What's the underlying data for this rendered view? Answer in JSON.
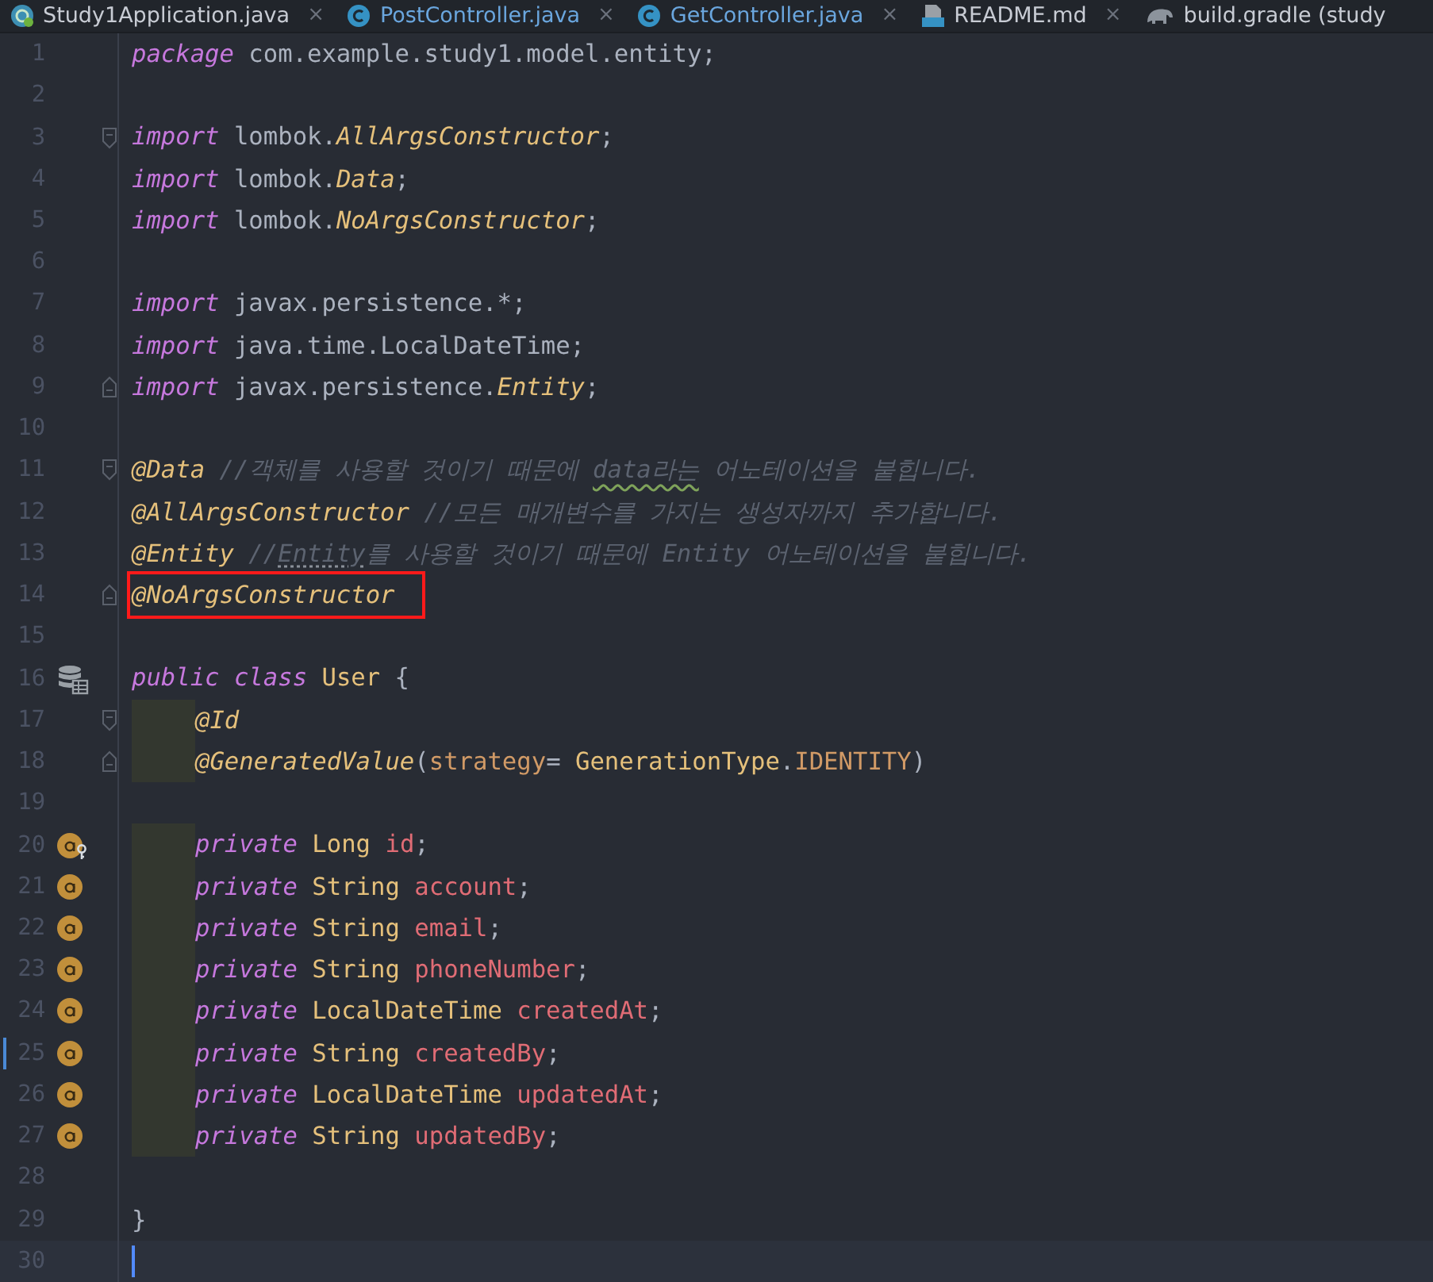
{
  "tabs": [
    {
      "label": "Study1Application.java",
      "kind": "app",
      "modified": false,
      "close": "×"
    },
    {
      "label": "PostController.java",
      "kind": "class",
      "modified": true,
      "close": "×"
    },
    {
      "label": "GetController.java",
      "kind": "class",
      "modified": true,
      "close": "×"
    },
    {
      "label": "README.md",
      "kind": "markdown",
      "modified": false,
      "close": "×"
    },
    {
      "label": "build.gradle (study",
      "kind": "gradle",
      "modified": false
    }
  ],
  "lines": [
    {
      "number": "1",
      "tokens": [
        {
          "kind": "keyword",
          "text": "package"
        },
        {
          "kind": "plain",
          "text": " com.example.study1.model.entity;"
        }
      ]
    },
    {
      "number": "2"
    },
    {
      "number": "3",
      "fold_start": true,
      "tokens": [
        {
          "kind": "keyword",
          "text": "import"
        },
        {
          "kind": "plain",
          "text": " lombok."
        },
        {
          "kind": "class",
          "text": "AllArgsConstructor"
        },
        {
          "kind": "plain",
          "text": ";"
        }
      ]
    },
    {
      "number": "4",
      "tokens": [
        {
          "kind": "keyword",
          "text": "import"
        },
        {
          "kind": "plain",
          "text": " lombok."
        },
        {
          "kind": "class",
          "text": "Data"
        },
        {
          "kind": "plain",
          "text": ";"
        }
      ]
    },
    {
      "number": "5",
      "tokens": [
        {
          "kind": "keyword",
          "text": "import"
        },
        {
          "kind": "plain",
          "text": " lombok."
        },
        {
          "kind": "class",
          "text": "NoArgsConstructor"
        },
        {
          "kind": "plain",
          "text": ";"
        }
      ]
    },
    {
      "number": "6"
    },
    {
      "number": "7",
      "tokens": [
        {
          "kind": "keyword",
          "text": "import"
        },
        {
          "kind": "plain",
          "text": " javax.persistence.*;"
        }
      ]
    },
    {
      "number": "8",
      "tokens": [
        {
          "kind": "keyword",
          "text": "import"
        },
        {
          "kind": "plain",
          "text": " java.time.LocalDateTime;"
        }
      ]
    },
    {
      "number": "9",
      "fold_end": true,
      "tokens": [
        {
          "kind": "keyword",
          "text": "import"
        },
        {
          "kind": "plain",
          "text": " javax.persistence."
        },
        {
          "kind": "class",
          "text": "Entity"
        },
        {
          "kind": "plain",
          "text": ";"
        }
      ]
    },
    {
      "number": "10"
    },
    {
      "number": "11",
      "fold_start": true,
      "tokens": [
        {
          "kind": "annotation",
          "text": "@Data"
        },
        {
          "kind": "comment",
          "text": " //객체를 사용할 것이기 때문에 "
        },
        {
          "kind": "comment",
          "text": "data라는",
          "misspelled": true
        },
        {
          "kind": "comment",
          "text": " 어노테이션을 붙힙니다."
        }
      ]
    },
    {
      "number": "12",
      "tokens": [
        {
          "kind": "annotation",
          "text": "@AllArgsConstructor"
        },
        {
          "kind": "comment",
          "text": " //모든 매개변수를 가지는 생성자까지 추가합니다."
        }
      ]
    },
    {
      "number": "13",
      "tokens": [
        {
          "kind": "annotation",
          "text": "@Entity"
        },
        {
          "kind": "comment",
          "text": " //"
        },
        {
          "kind": "comment",
          "text": "Entity",
          "reference": true
        },
        {
          "kind": "comment",
          "text": "를 사용할 것이기 때문에 Entity 어노테이션을 붙힙니다."
        }
      ]
    },
    {
      "number": "14",
      "fold_end": true,
      "highlighted": true,
      "tokens": [
        {
          "kind": "annotation",
          "text": "@NoArgsConstructor"
        }
      ]
    },
    {
      "number": "15"
    },
    {
      "number": "16",
      "kind": "entity",
      "tokens": [
        {
          "kind": "keyword",
          "text": "public"
        },
        {
          "kind": "keyword",
          "text": " class"
        },
        {
          "kind": "type",
          "text": " User"
        },
        {
          "kind": "plain",
          "text": " {"
        }
      ]
    },
    {
      "number": "17",
      "fold_start": true,
      "indent": true,
      "tokens": [
        {
          "kind": "annotation",
          "text": "@Id"
        }
      ]
    },
    {
      "number": "18",
      "fold_end": true,
      "indent": true,
      "tokens": [
        {
          "kind": "annotation",
          "text": "@GeneratedValue"
        },
        {
          "kind": "plain",
          "text": "("
        },
        {
          "kind": "param",
          "text": "strategy"
        },
        {
          "kind": "plain",
          "text": "= "
        },
        {
          "kind": "type",
          "text": "GenerationType"
        },
        {
          "kind": "plain",
          "text": "."
        },
        {
          "kind": "constant",
          "text": "IDENTITY"
        },
        {
          "kind": "plain",
          "text": ")"
        }
      ]
    },
    {
      "number": "19"
    },
    {
      "number": "20",
      "kind": "field-key",
      "indent": true,
      "tokens": [
        {
          "kind": "keyword",
          "text": "private"
        },
        {
          "kind": "type",
          "text": " Long"
        },
        {
          "kind": "field",
          "text": " id"
        },
        {
          "kind": "plain",
          "text": ";"
        }
      ]
    },
    {
      "number": "21",
      "kind": "field",
      "indent": true,
      "tokens": [
        {
          "kind": "keyword",
          "text": "private"
        },
        {
          "kind": "type",
          "text": " String"
        },
        {
          "kind": "field",
          "text": " account"
        },
        {
          "kind": "plain",
          "text": ";"
        }
      ]
    },
    {
      "number": "22",
      "kind": "field",
      "indent": true,
      "tokens": [
        {
          "kind": "keyword",
          "text": "private"
        },
        {
          "kind": "type",
          "text": " String"
        },
        {
          "kind": "field",
          "text": " email"
        },
        {
          "kind": "plain",
          "text": ";"
        }
      ]
    },
    {
      "number": "23",
      "kind": "field",
      "indent": true,
      "tokens": [
        {
          "kind": "keyword",
          "text": "private"
        },
        {
          "kind": "type",
          "text": " String"
        },
        {
          "kind": "field",
          "text": " phoneNumber"
        },
        {
          "kind": "plain",
          "text": ";"
        }
      ]
    },
    {
      "number": "24",
      "kind": "field",
      "indent": true,
      "tokens": [
        {
          "kind": "keyword",
          "text": "private"
        },
        {
          "kind": "type",
          "text": " LocalDateTime"
        },
        {
          "kind": "field",
          "text": " createdAt"
        },
        {
          "kind": "plain",
          "text": ";"
        }
      ]
    },
    {
      "number": "25",
      "kind": "field",
      "indent": true,
      "changed": true,
      "tokens": [
        {
          "kind": "keyword",
          "text": "private"
        },
        {
          "kind": "type",
          "text": " String"
        },
        {
          "kind": "field",
          "text": " createdBy"
        },
        {
          "kind": "plain",
          "text": ";"
        }
      ]
    },
    {
      "number": "26",
      "kind": "field",
      "indent": true,
      "tokens": [
        {
          "kind": "keyword",
          "text": "private"
        },
        {
          "kind": "type",
          "text": " LocalDateTime"
        },
        {
          "kind": "field",
          "text": " updatedAt"
        },
        {
          "kind": "plain",
          "text": ";"
        }
      ]
    },
    {
      "number": "27",
      "kind": "field",
      "indent": true,
      "tokens": [
        {
          "kind": "keyword",
          "text": "private"
        },
        {
          "kind": "type",
          "text": " String"
        },
        {
          "kind": "field",
          "text": " updatedBy"
        },
        {
          "kind": "plain",
          "text": ";"
        }
      ]
    },
    {
      "number": "28"
    },
    {
      "number": "29",
      "tokens": [
        {
          "kind": "plain",
          "text": "}"
        }
      ]
    },
    {
      "number": "30",
      "current": true
    }
  ]
}
